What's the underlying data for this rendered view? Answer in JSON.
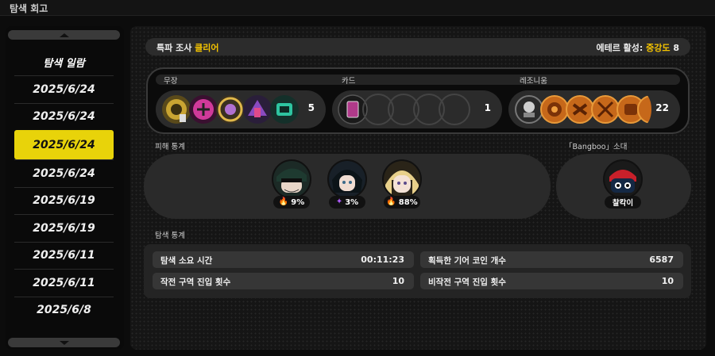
{
  "window": {
    "title": "탐색 회고"
  },
  "sidebar": {
    "header": "탐색 일람",
    "items": [
      {
        "label": "2025/6/24",
        "active": false
      },
      {
        "label": "2025/6/24",
        "active": false
      },
      {
        "label": "2025/6/24",
        "active": true
      },
      {
        "label": "2025/6/24",
        "active": false
      },
      {
        "label": "2025/6/19",
        "active": false
      },
      {
        "label": "2025/6/19",
        "active": false
      },
      {
        "label": "2025/6/11",
        "active": false
      },
      {
        "label": "2025/6/11",
        "active": false
      },
      {
        "label": "2025/6/8",
        "active": false
      }
    ]
  },
  "topbar": {
    "mission": "특파 조사",
    "result": "클리어",
    "ether_label": "에테르 활성:",
    "ether_level": "중강도",
    "ether_value": "8"
  },
  "gear": {
    "weapons_label": "무장",
    "weapons_count": "5",
    "cards_label": "카드",
    "cards_count": "1",
    "resonium_label": "레조니움",
    "resonium_count": "22"
  },
  "damage": {
    "label": "피해 통계",
    "agents": [
      {
        "percent": "9%",
        "element": "fire-icon"
      },
      {
        "percent": "3%",
        "element": "ether-icon"
      },
      {
        "percent": "88%",
        "element": "fire-icon"
      }
    ]
  },
  "bangboo": {
    "label": "「Bangboo」소대",
    "name": "찰칵이"
  },
  "stats": {
    "label": "탐색 통계",
    "rows": [
      {
        "label": "탐색 소요 시간",
        "value": "00:11:23"
      },
      {
        "label": "획득한 기어 코인 개수",
        "value": "6587"
      },
      {
        "label": "작전 구역 진입 횟수",
        "value": "10"
      },
      {
        "label": "비작전 구역 진입 횟수",
        "value": "10"
      }
    ]
  },
  "colors": {
    "accent_yellow": "#e8d30a",
    "highlight_text": "#f5c400",
    "fire": "#ff5a2a",
    "ether": "#b05cff"
  }
}
